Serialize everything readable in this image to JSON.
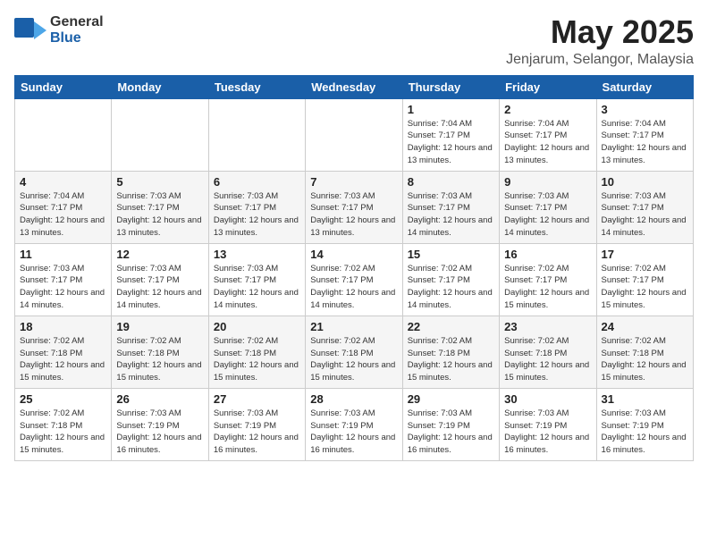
{
  "logo": {
    "general": "General",
    "blue": "Blue"
  },
  "title": {
    "month": "May 2025",
    "location": "Jenjarum, Selangor, Malaysia"
  },
  "weekdays": [
    "Sunday",
    "Monday",
    "Tuesday",
    "Wednesday",
    "Thursday",
    "Friday",
    "Saturday"
  ],
  "weeks": [
    [
      {
        "day": "",
        "info": ""
      },
      {
        "day": "",
        "info": ""
      },
      {
        "day": "",
        "info": ""
      },
      {
        "day": "",
        "info": ""
      },
      {
        "day": "1",
        "info": "Sunrise: 7:04 AM\nSunset: 7:17 PM\nDaylight: 12 hours\nand 13 minutes."
      },
      {
        "day": "2",
        "info": "Sunrise: 7:04 AM\nSunset: 7:17 PM\nDaylight: 12 hours\nand 13 minutes."
      },
      {
        "day": "3",
        "info": "Sunrise: 7:04 AM\nSunset: 7:17 PM\nDaylight: 12 hours\nand 13 minutes."
      }
    ],
    [
      {
        "day": "4",
        "info": "Sunrise: 7:04 AM\nSunset: 7:17 PM\nDaylight: 12 hours\nand 13 minutes."
      },
      {
        "day": "5",
        "info": "Sunrise: 7:03 AM\nSunset: 7:17 PM\nDaylight: 12 hours\nand 13 minutes."
      },
      {
        "day": "6",
        "info": "Sunrise: 7:03 AM\nSunset: 7:17 PM\nDaylight: 12 hours\nand 13 minutes."
      },
      {
        "day": "7",
        "info": "Sunrise: 7:03 AM\nSunset: 7:17 PM\nDaylight: 12 hours\nand 13 minutes."
      },
      {
        "day": "8",
        "info": "Sunrise: 7:03 AM\nSunset: 7:17 PM\nDaylight: 12 hours\nand 14 minutes."
      },
      {
        "day": "9",
        "info": "Sunrise: 7:03 AM\nSunset: 7:17 PM\nDaylight: 12 hours\nand 14 minutes."
      },
      {
        "day": "10",
        "info": "Sunrise: 7:03 AM\nSunset: 7:17 PM\nDaylight: 12 hours\nand 14 minutes."
      }
    ],
    [
      {
        "day": "11",
        "info": "Sunrise: 7:03 AM\nSunset: 7:17 PM\nDaylight: 12 hours\nand 14 minutes."
      },
      {
        "day": "12",
        "info": "Sunrise: 7:03 AM\nSunset: 7:17 PM\nDaylight: 12 hours\nand 14 minutes."
      },
      {
        "day": "13",
        "info": "Sunrise: 7:03 AM\nSunset: 7:17 PM\nDaylight: 12 hours\nand 14 minutes."
      },
      {
        "day": "14",
        "info": "Sunrise: 7:02 AM\nSunset: 7:17 PM\nDaylight: 12 hours\nand 14 minutes."
      },
      {
        "day": "15",
        "info": "Sunrise: 7:02 AM\nSunset: 7:17 PM\nDaylight: 12 hours\nand 14 minutes."
      },
      {
        "day": "16",
        "info": "Sunrise: 7:02 AM\nSunset: 7:17 PM\nDaylight: 12 hours\nand 15 minutes."
      },
      {
        "day": "17",
        "info": "Sunrise: 7:02 AM\nSunset: 7:17 PM\nDaylight: 12 hours\nand 15 minutes."
      }
    ],
    [
      {
        "day": "18",
        "info": "Sunrise: 7:02 AM\nSunset: 7:18 PM\nDaylight: 12 hours\nand 15 minutes."
      },
      {
        "day": "19",
        "info": "Sunrise: 7:02 AM\nSunset: 7:18 PM\nDaylight: 12 hours\nand 15 minutes."
      },
      {
        "day": "20",
        "info": "Sunrise: 7:02 AM\nSunset: 7:18 PM\nDaylight: 12 hours\nand 15 minutes."
      },
      {
        "day": "21",
        "info": "Sunrise: 7:02 AM\nSunset: 7:18 PM\nDaylight: 12 hours\nand 15 minutes."
      },
      {
        "day": "22",
        "info": "Sunrise: 7:02 AM\nSunset: 7:18 PM\nDaylight: 12 hours\nand 15 minutes."
      },
      {
        "day": "23",
        "info": "Sunrise: 7:02 AM\nSunset: 7:18 PM\nDaylight: 12 hours\nand 15 minutes."
      },
      {
        "day": "24",
        "info": "Sunrise: 7:02 AM\nSunset: 7:18 PM\nDaylight: 12 hours\nand 15 minutes."
      }
    ],
    [
      {
        "day": "25",
        "info": "Sunrise: 7:02 AM\nSunset: 7:18 PM\nDaylight: 12 hours\nand 15 minutes."
      },
      {
        "day": "26",
        "info": "Sunrise: 7:03 AM\nSunset: 7:19 PM\nDaylight: 12 hours\nand 16 minutes."
      },
      {
        "day": "27",
        "info": "Sunrise: 7:03 AM\nSunset: 7:19 PM\nDaylight: 12 hours\nand 16 minutes."
      },
      {
        "day": "28",
        "info": "Sunrise: 7:03 AM\nSunset: 7:19 PM\nDaylight: 12 hours\nand 16 minutes."
      },
      {
        "day": "29",
        "info": "Sunrise: 7:03 AM\nSunset: 7:19 PM\nDaylight: 12 hours\nand 16 minutes."
      },
      {
        "day": "30",
        "info": "Sunrise: 7:03 AM\nSunset: 7:19 PM\nDaylight: 12 hours\nand 16 minutes."
      },
      {
        "day": "31",
        "info": "Sunrise: 7:03 AM\nSunset: 7:19 PM\nDaylight: 12 hours\nand 16 minutes."
      }
    ]
  ]
}
